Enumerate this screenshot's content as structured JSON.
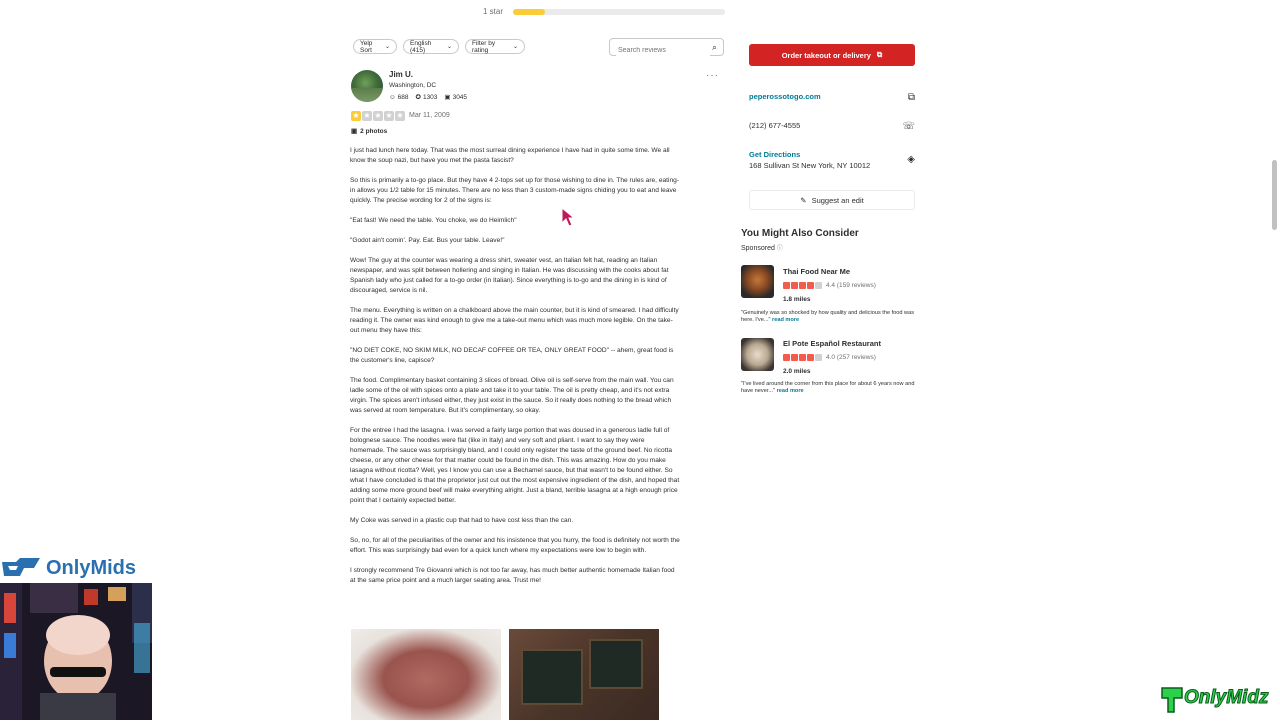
{
  "rating_breakdown": {
    "label": "1 star",
    "fill_fraction": 0.15,
    "fill_color": "#fbcc39"
  },
  "filters": {
    "sort_label": "Yelp Sort",
    "language_label": "English (415)",
    "rating_filter_label": "Filter by rating",
    "search_placeholder": "Search reviews",
    "icon": "search-icon"
  },
  "review": {
    "reviewer_name": "Jim U.",
    "reviewer_location": "Washington, DC",
    "stats": {
      "friends": "688",
      "reviews": "1303",
      "photos": "3045"
    },
    "rating": 1,
    "date": "Mar 11, 2009",
    "photo_count": "2 photos",
    "paragraphs": [
      "I just had lunch here today. That was the most surreal dining experience I have had in quite some time. We all know the soup nazi, but have you met the pasta fascist?",
      "So this is primarily a to-go place. But they have 4 2-tops set up for those wishing to dine in. The rules are, eating-in allows you 1/2 table for 15 minutes. There are no less than 3 custom-made signs chiding you to eat and leave quickly. The precise wording for 2 of the signs is:",
      "\"Eat fast! We need the table. You choke, we do Heimlich\"",
      "\"Godot ain't comin'. Pay. Eat. Bus your table. Leave!\"",
      "Wow! The guy at the counter was wearing a dress shirt, sweater vest, an Italian felt hat, reading an Italian newspaper, and was split between hollering and singing in Italian. He was discussing with the cooks about fat Spanish lady who just called for a to-go order (in Italian). Since everything is to-go and the dining in is kind of discouraged, service is nil.",
      "The menu. Everything is written on a chalkboard above the main counter, but it is kind of smeared. I had difficulty reading it. The owner was kind enough to give me a take-out menu which was much more legible. On the take-out menu they have this:",
      "\"NO DIET COKE, NO SKIM MILK, NO DECAF COFFEE OR TEA, ONLY GREAT FOOD\" -- ahem, great food is the customer's line, capisce?",
      "The food. Complimentary basket containing 3 slices of bread. Olive oil is self-serve from the main wall. You can ladle some of the oil with spices onto a plate and take it to your table. The oil is pretty cheap, and it's not extra virgin. The spices aren't infused either, they just exist in the sauce. So it really does nothing to the bread which was served at room temperature. But it's complimentary, so okay.",
      "For the entree I had the lasagna. I was served a fairly large portion that was doused in a generous ladle full of bolognese sauce. The noodles were flat (like in Italy) and very soft and pliant. I want to say they were homemade. The sauce was surprisingly bland, and I could only register the taste of the ground beef. No ricotta cheese, or any other cheese for that matter could be found in the dish. This was amazing. How do you make lasagna without ricotta? Well, yes I know you can use a Bechamel sauce, but that wasn't to be found either. So what I have concluded is that the proprietor just cut out the most expensive ingredient of the dish, and hoped that adding some more ground beef will make everything alright. Just a bland, terrible lasagna at a high enough price point that I certainly expected better.",
      "My Coke was served in a plastic cup that had to have cost less than the can.",
      "So, no, for all of the peculiarities of the owner and his insistence that you hurry, the food is definitely not worth the effort. This was surprisingly bad even for a quick lunch where my expectations were low to begin with.",
      "I strongly recommend Tre Giovanni which is not too far away, has much better authentic homemade Italian food at the same price point and a much larger seating area. Trust me!"
    ]
  },
  "sidebar": {
    "order_button": "Order takeout or delivery",
    "website": "peperossotogo.com",
    "phone": "(212) 677-4555",
    "directions_label": "Get Directions",
    "address": "168 Sullivan St New York, NY 10012",
    "suggest_button": "Suggest an edit",
    "consider_title": "You Might Also Consider",
    "sponsored_label": "Sponsored",
    "ads": [
      {
        "name": "Thai Food Near Me",
        "rating_value": 4.4,
        "rating_text": "4.4 (159 reviews)",
        "distance": "1.8 miles",
        "snippet": "\"Genuinely was so shocked by how quality and delicious the food was here. I've...\"",
        "read_more": "read more"
      },
      {
        "name": "El Pote Español Restaurant",
        "rating_value": 4.0,
        "rating_text": "4.0 (257 reviews)",
        "distance": "2.0 miles",
        "snippet": "\"I've lived around the corner from this place for about 6 years now and have never...\"",
        "read_more": "read more"
      }
    ]
  },
  "overlays": {
    "stream_logo_text": "OnlyMids",
    "watermark_text": "OnlyMidz"
  },
  "colors": {
    "brand_red": "#d32323",
    "link": "#027a97",
    "star_yellow": "#fbcc39",
    "ad_star": "#f15c4f"
  }
}
